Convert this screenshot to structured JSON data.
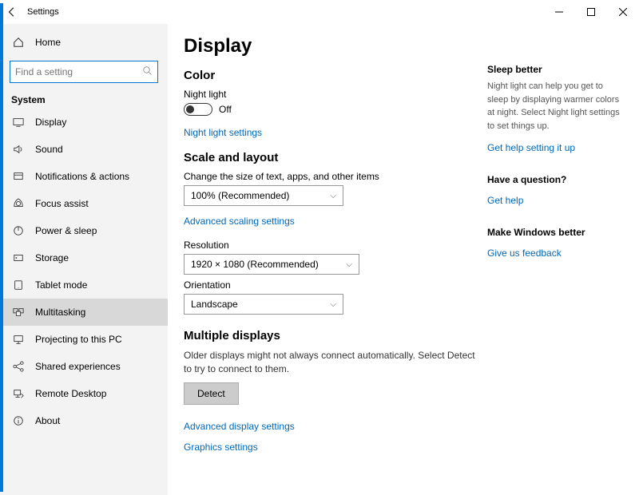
{
  "titlebar": {
    "title": "Settings"
  },
  "sidebar": {
    "home": "Home",
    "search_placeholder": "Find a setting",
    "group": "System",
    "items": [
      {
        "label": "Display"
      },
      {
        "label": "Sound"
      },
      {
        "label": "Notifications & actions"
      },
      {
        "label": "Focus assist"
      },
      {
        "label": "Power & sleep"
      },
      {
        "label": "Storage"
      },
      {
        "label": "Tablet mode"
      },
      {
        "label": "Multitasking"
      },
      {
        "label": "Projecting to this PC"
      },
      {
        "label": "Shared experiences"
      },
      {
        "label": "Remote Desktop"
      },
      {
        "label": "About"
      }
    ]
  },
  "page": {
    "title": "Display",
    "color_hdr": "Color",
    "night_light_label": "Night light",
    "night_light_state": "Off",
    "night_light_link": "Night light settings",
    "scale_hdr": "Scale and layout",
    "scale_label": "Change the size of text, apps, and other items",
    "scale_value": "100% (Recommended)",
    "scale_link": "Advanced scaling settings",
    "resolution_label": "Resolution",
    "resolution_value": "1920 × 1080 (Recommended)",
    "orientation_label": "Orientation",
    "orientation_value": "Landscape",
    "multiple_hdr": "Multiple displays",
    "multiple_desc": "Older displays might not always connect automatically. Select Detect to try to connect to them.",
    "detect_btn": "Detect",
    "adv_display_link": "Advanced display settings",
    "graphics_link": "Graphics settings"
  },
  "aside": {
    "sleep_hdr": "Sleep better",
    "sleep_desc": "Night light can help you get to sleep by displaying warmer colors at night. Select Night light settings to set things up.",
    "sleep_link": "Get help setting it up",
    "question_hdr": "Have a question?",
    "question_link": "Get help",
    "better_hdr": "Make Windows better",
    "better_link": "Give us feedback"
  }
}
